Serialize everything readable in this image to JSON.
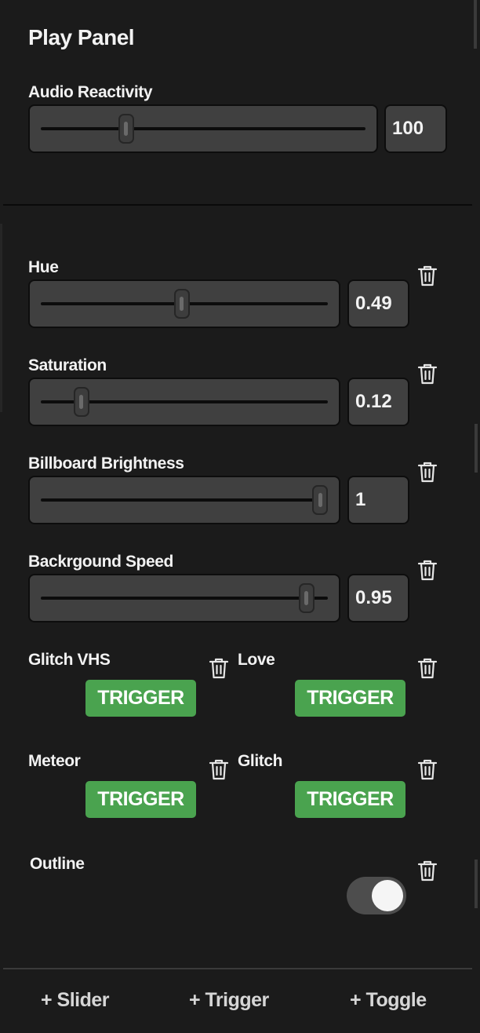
{
  "panel": {
    "title": "Play Panel"
  },
  "audio": {
    "label": "Audio Reactivity",
    "value": "100",
    "level": 0.25
  },
  "sliders": [
    {
      "label": "Hue",
      "value": "0.49",
      "level": 0.49
    },
    {
      "label": "Saturation",
      "value": "0.12",
      "level": 0.12
    },
    {
      "label": "Billboard Brightness",
      "value": "1",
      "level": 1
    },
    {
      "label": "Backrgound Speed",
      "value": "0.95",
      "level": 0.95
    }
  ],
  "triggers": [
    {
      "label": "Glitch VHS",
      "button": "TRIGGER"
    },
    {
      "label": "Love",
      "button": "TRIGGER"
    },
    {
      "label": "Meteor",
      "button": "TRIGGER"
    },
    {
      "label": "Glitch",
      "button": "TRIGGER"
    }
  ],
  "toggle": {
    "label": "Outline",
    "on": true
  },
  "footer": {
    "add_slider": "+ Slider",
    "add_trigger": "+ Trigger",
    "add_toggle": "+ Toggle"
  },
  "icons": {
    "delete": "trash-icon"
  },
  "colors": {
    "background": "#1b1b1b",
    "trigger": "#4aa34f"
  }
}
